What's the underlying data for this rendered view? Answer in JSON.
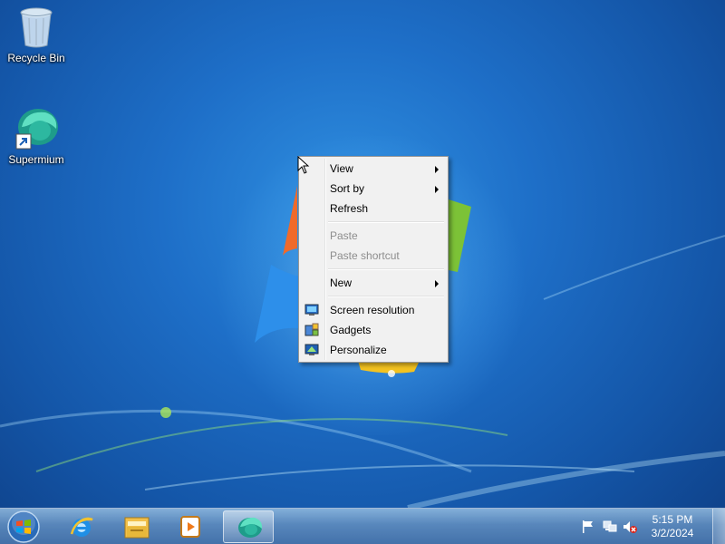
{
  "desktop": {
    "icons": [
      {
        "label": "Recycle Bin",
        "icon": "recycle-bin-icon"
      },
      {
        "label": "Supermium",
        "icon": "supermium-icon"
      }
    ]
  },
  "context_menu": {
    "items": [
      {
        "label": "View",
        "enabled": true,
        "submenu": true
      },
      {
        "label": "Sort by",
        "enabled": true,
        "submenu": true
      },
      {
        "label": "Refresh",
        "enabled": true
      },
      {
        "label": "Paste",
        "enabled": false
      },
      {
        "label": "Paste shortcut",
        "enabled": false
      },
      {
        "label": "New",
        "enabled": true,
        "submenu": true
      },
      {
        "label": "Screen resolution",
        "enabled": true,
        "icon": "screen-resolution-icon"
      },
      {
        "label": "Gadgets",
        "enabled": true,
        "icon": "gadgets-icon"
      },
      {
        "label": "Personalize",
        "enabled": true,
        "icon": "personalize-icon"
      }
    ]
  },
  "taskbar": {
    "pinned": [
      {
        "name": "internet-explorer-icon"
      },
      {
        "name": "windows-explorer-icon"
      },
      {
        "name": "media-player-icon"
      },
      {
        "name": "supermium-icon",
        "active": true
      }
    ],
    "tray": {
      "icons": [
        "action-center-flag-icon",
        "network-icon",
        "volume-muted-icon"
      ],
      "time": "5:15 PM",
      "date": "3/2/2024"
    }
  },
  "colors": {
    "desktop_blue": "#1e6fc8",
    "menu_bg": "#f1f1f1",
    "disabled_text": "#8d8d8d"
  }
}
